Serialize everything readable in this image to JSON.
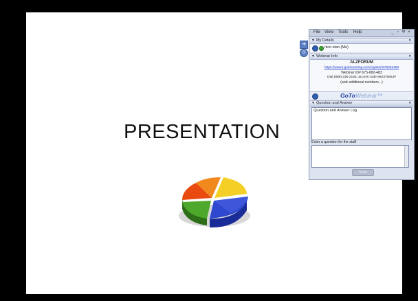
{
  "slide": {
    "title": "PRESENTATION"
  },
  "gtw": {
    "menu": [
      "File",
      "View",
      "Tools",
      "Help"
    ],
    "window_buttons": [
      "_",
      "▫",
      "Ψ",
      "×"
    ],
    "my_details": {
      "header": "My Details",
      "user": "nico stan (Me)"
    },
    "webinar_info": {
      "header": "Webinar Info",
      "name": "ALZFORUM",
      "url": "https://www1.gotomeeting.com/register/675682483",
      "webinar_id": "Webinar ID# 675-682-483",
      "dial": "Dial (888) 236-2165, access code 860378923#",
      "additional": "(and additional numbers...)",
      "brand_goto": "GoTo",
      "brand_webinar": "Webinar™"
    },
    "qa": {
      "header": "Question and Answer",
      "log_text": "Question and Answer Log",
      "prompt": "Enter a question for the staff",
      "send_label": "Send"
    },
    "colors": {
      "accent": "#1a3fd0",
      "panel": "#dde3ef",
      "green_status": "#3aa531"
    }
  },
  "icons": [
    "arrow-icon",
    "gotowebinar-icon",
    "status-dot-icon"
  ]
}
